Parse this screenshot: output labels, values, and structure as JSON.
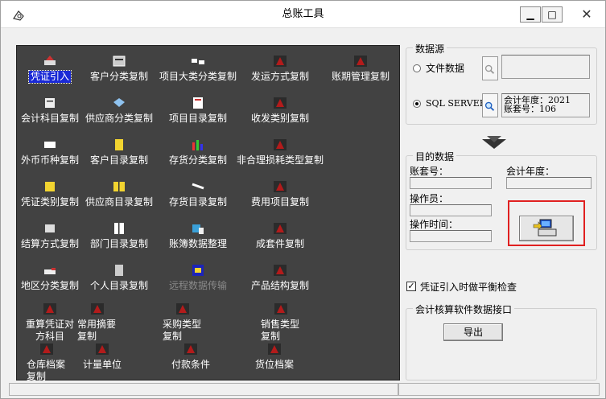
{
  "window": {
    "title": "总账工具",
    "minimize_glyph": "▁",
    "maximize_glyph": "□",
    "close_glyph": "✕"
  },
  "tools": [
    {
      "label": "凭证引入",
      "icon": "voucher-import-icon"
    },
    {
      "label": "客户分类复制",
      "icon": "customer-class-icon"
    },
    {
      "label": "项目大类分类复制",
      "icon": "project-class-icon"
    },
    {
      "label": "发运方式复制",
      "icon": "shipping-icon"
    },
    {
      "label": "账期管理复制",
      "icon": "period-icon"
    },
    {
      "label": "会计科目复制",
      "icon": "accounts-icon"
    },
    {
      "label": "供应商分类复制",
      "icon": "supplier-class-icon"
    },
    {
      "label": "项目目录复制",
      "icon": "project-list-icon"
    },
    {
      "label": "收发类别复制",
      "icon": "send-receive-icon"
    },
    {
      "label": "外币币种复制",
      "icon": "currency-icon"
    },
    {
      "label": "客户目录复制",
      "icon": "customer-list-icon"
    },
    {
      "label": "存货分类复制",
      "icon": "inventory-class-icon"
    },
    {
      "label": "非合理损耗类型复制",
      "icon": "loss-type-icon"
    },
    {
      "label": "凭证类别复制",
      "icon": "voucher-type-icon"
    },
    {
      "label": "供应商目录复制",
      "icon": "supplier-list-icon"
    },
    {
      "label": "存货目录复制",
      "icon": "inventory-list-icon"
    },
    {
      "label": "费用项目复制",
      "icon": "expense-icon"
    },
    {
      "label": "结算方式复制",
      "icon": "settlement-icon"
    },
    {
      "label": "部门目录复制",
      "icon": "department-icon"
    },
    {
      "label": "账簿数据整理",
      "icon": "ledger-icon"
    },
    {
      "label": "成套件复制",
      "icon": "kit-icon"
    },
    {
      "label": "地区分类复制",
      "icon": "region-icon"
    },
    {
      "label": "个人目录复制",
      "icon": "person-icon"
    },
    {
      "label": "远程数据传输",
      "icon": "remote-icon"
    },
    {
      "label": "产品结构复制",
      "icon": "bom-icon"
    },
    {
      "label": "重算凭证对方科目",
      "icon": "recalc-icon"
    },
    {
      "label": "常用摘要复制",
      "icon": "summary-icon"
    },
    {
      "label": "采购类型复制",
      "icon": "purchase-icon"
    },
    {
      "label": "销售类型复制",
      "icon": "sales-icon"
    },
    {
      "label": "仓库档案复制",
      "icon": "warehouse-icon"
    },
    {
      "label": "计量单位",
      "icon": "unit-icon"
    },
    {
      "label": "付款条件",
      "icon": "payment-icon"
    },
    {
      "label": "货位档案",
      "icon": "location-icon"
    }
  ],
  "source": {
    "group_title": "数据源",
    "file_option": "文件数据",
    "sql_option": "SQL SERVER",
    "info_year": "会计年度：2021",
    "info_account": "账套号：106"
  },
  "target": {
    "group_title": "目的数据",
    "account_label": "账套号：",
    "year_label": "会计年度：",
    "operator_label": "操作员：",
    "time_label": "操作时间："
  },
  "balance_check_label": "凭证引入时做平衡检查",
  "interface": {
    "group_title": "会计核算软件数据接口",
    "export_label": "导出"
  },
  "colors": {
    "panel_bg": "#424242",
    "selected_bg": "#1a2ad6",
    "highlight_box": "#e02020"
  }
}
